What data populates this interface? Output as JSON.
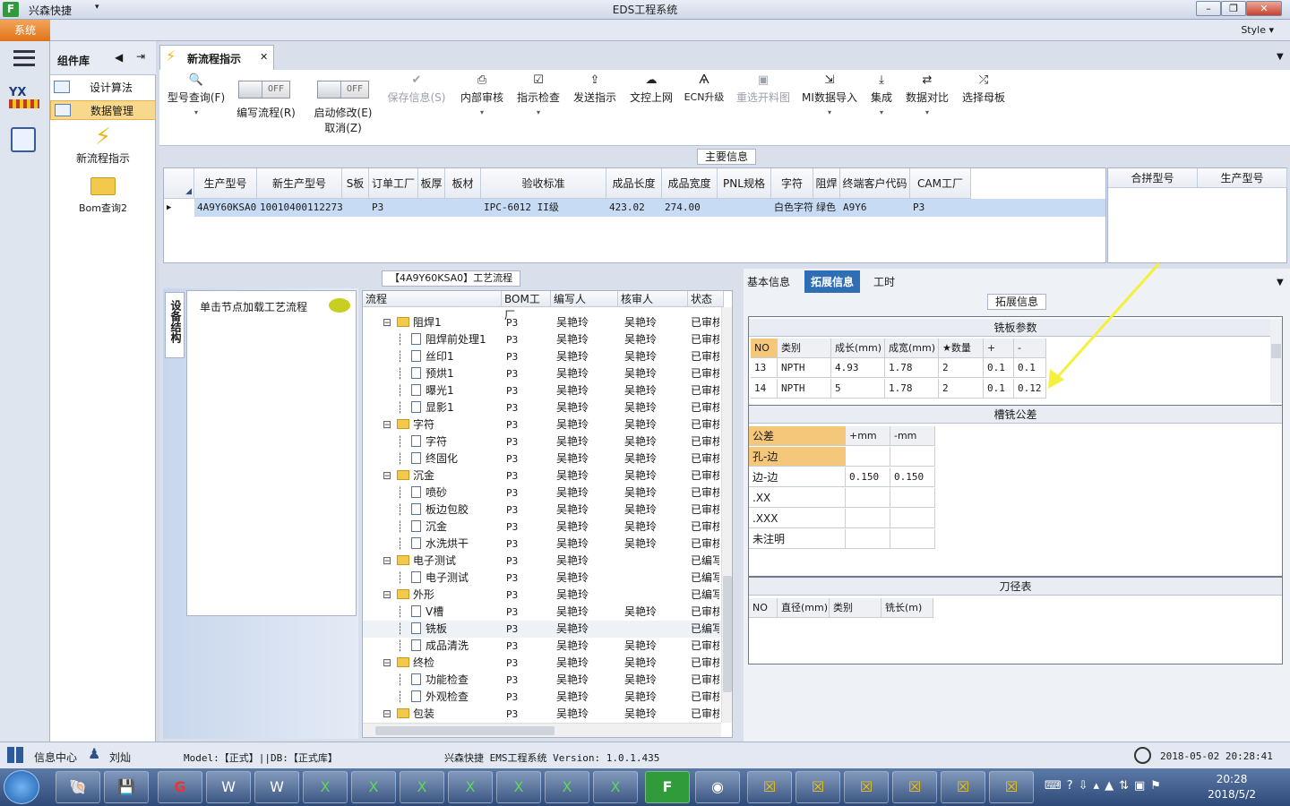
{
  "app": {
    "name": "兴森快捷",
    "window_title": "EDS工程系统",
    "style_label": "Style",
    "system_tab": "系统"
  },
  "library": {
    "title": "组件库",
    "items": [
      {
        "label": "设计算法"
      },
      {
        "label": "数据管理"
      }
    ],
    "big_items": [
      {
        "label": "新流程指示"
      },
      {
        "label": "Bom查询2"
      }
    ]
  },
  "document_tab": {
    "label": "新流程指示"
  },
  "ribbon": {
    "model_query": "型号查询(F)",
    "toggle_edit": {
      "state": "OFF",
      "label": "编写流程(R)"
    },
    "toggle_modify": {
      "state": "OFF",
      "label1": "启动修改(E)",
      "label2": "取消(Z)"
    },
    "buttons": [
      {
        "label": "保存信息(S)",
        "disabled": true
      },
      {
        "label": "内部审核",
        "disabled": false
      },
      {
        "label": "指示检查",
        "disabled": false
      },
      {
        "label": "发送指示",
        "disabled": false
      },
      {
        "label": "文控上网",
        "disabled": false
      },
      {
        "label": "ECN升级",
        "disabled": false
      },
      {
        "label": "重选开料图",
        "disabled": true
      },
      {
        "label": "MI数据导入",
        "disabled": false
      },
      {
        "label": "集成",
        "disabled": false
      },
      {
        "label": "数据对比",
        "disabled": false
      },
      {
        "label": "选择母板",
        "disabled": false
      }
    ]
  },
  "main_info": {
    "title": "主要信息",
    "columns": [
      "生产型号",
      "新生产型号",
      "S板",
      "订单工厂",
      "板厚",
      "板材",
      "验收标准",
      "成品长度",
      "成品宽度",
      "PNL规格",
      "字符",
      "阻焊",
      "终端客户代码",
      "CAM工厂"
    ],
    "row": [
      "4A9Y60KSA0",
      "10010400112273",
      "",
      "P3",
      "",
      "",
      "IPC-6012 II级",
      "423.02",
      "274.00",
      "",
      "白色字符",
      "绿色",
      "A9Y6",
      "P3"
    ],
    "side_columns": [
      "合拼型号",
      "生产型号"
    ]
  },
  "process": {
    "title": "【4A9Y60KSA0】工艺流程",
    "side_tab": "设备结构",
    "hint": "单击节点加载工艺流程",
    "columns": [
      "流程",
      "BOM工厂",
      "编写人",
      "核审人",
      "状态"
    ],
    "rows": [
      {
        "name": "阻焊1",
        "folder": true,
        "level": 0,
        "bom": "P3",
        "writer": "吴艳玲",
        "reviewer": "吴艳玲",
        "status": "已审核"
      },
      {
        "name": "阻焊前处理1",
        "folder": false,
        "level": 1,
        "bom": "P3",
        "writer": "吴艳玲",
        "reviewer": "吴艳玲",
        "status": "已审核"
      },
      {
        "name": "丝印1",
        "folder": false,
        "level": 1,
        "bom": "P3",
        "writer": "吴艳玲",
        "reviewer": "吴艳玲",
        "status": "已审核"
      },
      {
        "name": "预烘1",
        "folder": false,
        "level": 1,
        "bom": "P3",
        "writer": "吴艳玲",
        "reviewer": "吴艳玲",
        "status": "已审核"
      },
      {
        "name": "曝光1",
        "folder": false,
        "level": 1,
        "bom": "P3",
        "writer": "吴艳玲",
        "reviewer": "吴艳玲",
        "status": "已审核"
      },
      {
        "name": "显影1",
        "folder": false,
        "level": 1,
        "bom": "P3",
        "writer": "吴艳玲",
        "reviewer": "吴艳玲",
        "status": "已审核"
      },
      {
        "name": "字符",
        "folder": true,
        "level": 0,
        "bom": "P3",
        "writer": "吴艳玲",
        "reviewer": "吴艳玲",
        "status": "已审核"
      },
      {
        "name": "字符",
        "folder": false,
        "level": 1,
        "bom": "P3",
        "writer": "吴艳玲",
        "reviewer": "吴艳玲",
        "status": "已审核"
      },
      {
        "name": "终固化",
        "folder": false,
        "level": 1,
        "bom": "P3",
        "writer": "吴艳玲",
        "reviewer": "吴艳玲",
        "status": "已审核"
      },
      {
        "name": "沉金",
        "folder": true,
        "level": 0,
        "bom": "P3",
        "writer": "吴艳玲",
        "reviewer": "吴艳玲",
        "status": "已审核"
      },
      {
        "name": "喷砂",
        "folder": false,
        "level": 1,
        "bom": "P3",
        "writer": "吴艳玲",
        "reviewer": "吴艳玲",
        "status": "已审核"
      },
      {
        "name": "板边包胶",
        "folder": false,
        "level": 1,
        "bom": "P3",
        "writer": "吴艳玲",
        "reviewer": "吴艳玲",
        "status": "已审核"
      },
      {
        "name": "沉金",
        "folder": false,
        "level": 1,
        "bom": "P3",
        "writer": "吴艳玲",
        "reviewer": "吴艳玲",
        "status": "已审核"
      },
      {
        "name": "水洗烘干",
        "folder": false,
        "level": 1,
        "bom": "P3",
        "writer": "吴艳玲",
        "reviewer": "吴艳玲",
        "status": "已审核"
      },
      {
        "name": "电子测试",
        "folder": true,
        "level": 0,
        "bom": "P3",
        "writer": "吴艳玲",
        "reviewer": "",
        "status": "已编写"
      },
      {
        "name": "电子测试",
        "folder": false,
        "level": 1,
        "bom": "P3",
        "writer": "吴艳玲",
        "reviewer": "",
        "status": "已编写"
      },
      {
        "name": "外形",
        "folder": true,
        "level": 0,
        "bom": "P3",
        "writer": "吴艳玲",
        "reviewer": "",
        "status": "已编写"
      },
      {
        "name": "V槽",
        "folder": false,
        "level": 1,
        "bom": "P3",
        "writer": "吴艳玲",
        "reviewer": "吴艳玲",
        "status": "已审核"
      },
      {
        "name": "铣板",
        "folder": false,
        "level": 1,
        "bom": "P3",
        "writer": "吴艳玲",
        "reviewer": "",
        "status": "已编写"
      },
      {
        "name": "成品清洗",
        "folder": false,
        "level": 1,
        "bom": "P3",
        "writer": "吴艳玲",
        "reviewer": "吴艳玲",
        "status": "已审核"
      },
      {
        "name": "终检",
        "folder": true,
        "level": 0,
        "bom": "P3",
        "writer": "吴艳玲",
        "reviewer": "吴艳玲",
        "status": "已审核"
      },
      {
        "name": "功能检查",
        "folder": false,
        "level": 1,
        "bom": "P3",
        "writer": "吴艳玲",
        "reviewer": "吴艳玲",
        "status": "已审核"
      },
      {
        "name": "外观检查",
        "folder": false,
        "level": 1,
        "bom": "P3",
        "writer": "吴艳玲",
        "reviewer": "吴艳玲",
        "status": "已审核"
      },
      {
        "name": "包装",
        "folder": true,
        "level": 0,
        "bom": "P3",
        "writer": "吴艳玲",
        "reviewer": "吴艳玲",
        "status": "已审核"
      }
    ]
  },
  "ext": {
    "tabs": [
      "基本信息",
      "拓展信息",
      "工时"
    ],
    "title": "拓展信息",
    "mill": {
      "title": "铣板参数",
      "columns": [
        "NO",
        "类别",
        "成长(mm)",
        "成宽(mm)",
        "★数量",
        "+",
        "-"
      ],
      "rows": [
        [
          "13",
          "NPTH",
          "4.93",
          "1.78",
          "2",
          "0.1",
          "0.1"
        ],
        [
          "14",
          "NPTH",
          "5",
          "1.78",
          "2",
          "0.1",
          "0.12"
        ]
      ]
    },
    "tol": {
      "title": "槽铣公差",
      "columns": [
        "公差",
        "+mm",
        "-mm"
      ],
      "rows": [
        [
          "孔-边",
          "",
          ""
        ],
        [
          "边-边",
          "0.150",
          "0.150"
        ],
        [
          ".XX",
          "",
          ""
        ],
        [
          ".XXX",
          "",
          ""
        ],
        [
          "未注明",
          "",
          ""
        ]
      ]
    },
    "tool": {
      "title": "刀径表",
      "columns": [
        "NO",
        "直径(mm)",
        "类别",
        "铣长(m)"
      ]
    }
  },
  "status": {
    "info_center": "信息中心",
    "user": "刘灿",
    "model": "Model:【正式】||DB:【正式库】",
    "version": "兴森快捷 EMS工程系统 Version: 1.0.1.435",
    "datetime": "2018-05-02 20:28:41"
  },
  "clock": {
    "time": "20:28",
    "date": "2018/5/2"
  },
  "colors": {
    "accent_orange": "#e07417",
    "selection_blue": "#c7dcf4",
    "arrow_yellow": "#f5f03a"
  }
}
